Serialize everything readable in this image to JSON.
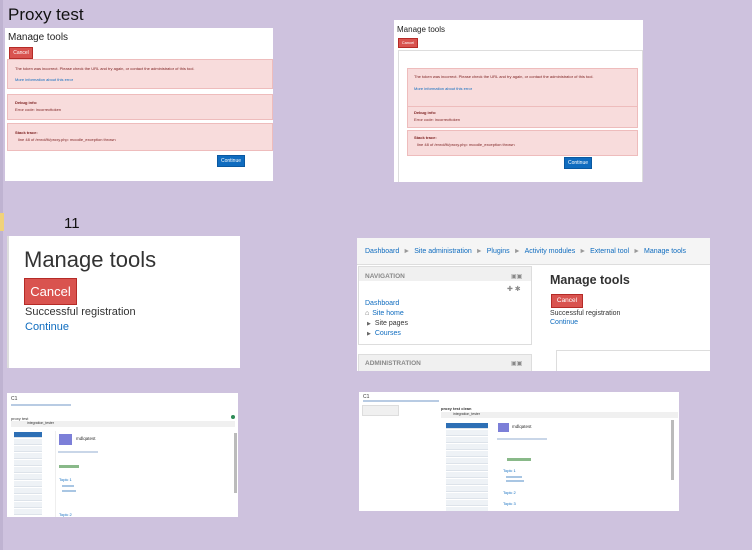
{
  "header": {
    "title": "Proxy test",
    "sidebar_number": "11"
  },
  "top_left": {
    "title": "Manage tools",
    "cancel": "Cancel",
    "error": "The token was incorrect. Please check the URL and try again, or contact the administrator of this tool.",
    "more_info": "More information about this error",
    "debug_title": "Debug info:",
    "debug_text": "Error code: incorrecttoken",
    "stack_title": "Stack trace:",
    "stack_text": "line 48 of /enrol/lti/proxy.php: moodle_exception thrown",
    "continue": "Continue"
  },
  "top_right": {
    "title": "Manage tools",
    "cancel": "Cancel",
    "error": "The token was incorrect. Please check the URL and try again, or contact the administrator of this tool.",
    "more_info": "More information about this error",
    "debug_title": "Debug info:",
    "debug_text": "Error code: incorrecttoken",
    "stack_title": "Stack trace:",
    "stack_text": "line 48 of /enrol/lti/proxy.php: moodle_exception thrown",
    "continue": "Continue"
  },
  "mid_left": {
    "title": "Manage tools",
    "cancel": "Cancel",
    "message": "Successful registration",
    "continue": "Continue"
  },
  "mid_right": {
    "breadcrumb": [
      "Dashboard",
      "Site administration",
      "Plugins",
      "Activity modules",
      "External tool",
      "Manage tools"
    ],
    "nav_title": "NAVIGATION",
    "nav_items": [
      "Dashboard",
      "Site home",
      "Site pages",
      "Courses"
    ],
    "admin_title": "ADMINISTRATION",
    "title": "Manage tools",
    "cancel": "Cancel",
    "message": "Successful registration",
    "continue": "Continue"
  },
  "bottom_left": {
    "course": "C1",
    "page_title": "proxy test",
    "user": "integration_tester",
    "card_title": "mdlqatest",
    "topic1": "Topic 1",
    "topic2": "Topic 2"
  },
  "bottom_right": {
    "course": "C1",
    "page_title": "proxy test clean",
    "user": "integration_tester",
    "card_title": "mdlqatest",
    "topic1": "Topic 1",
    "topic2": "Topic 2",
    "topic3": "Topic 3"
  }
}
